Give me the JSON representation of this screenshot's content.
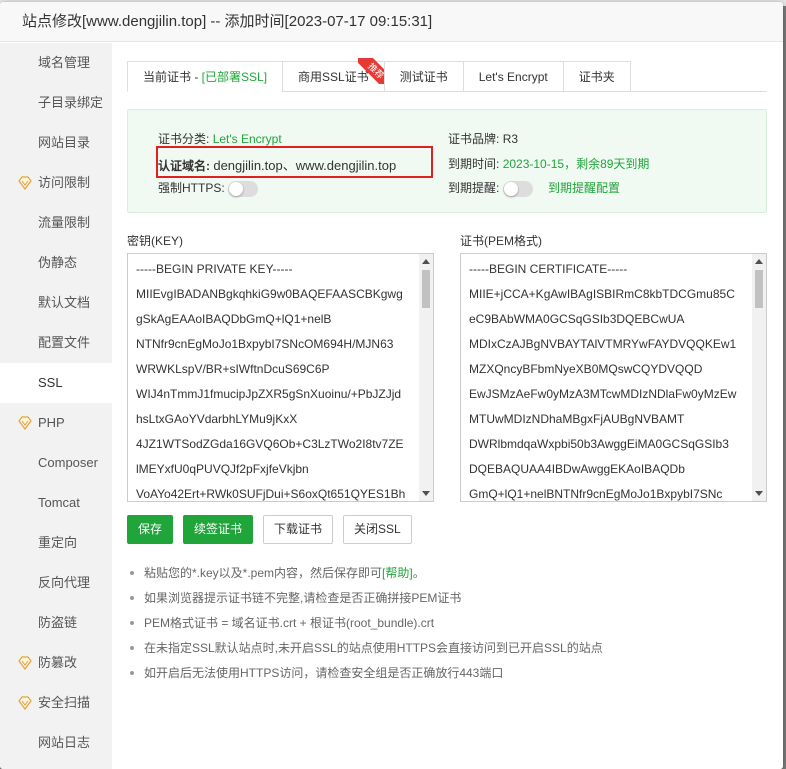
{
  "dialog": {
    "title": "站点修改[www.dengjilin.top] -- 添加时间[2023-07-17 09:15:31]",
    "close_label": "×"
  },
  "sidebar": {
    "items": [
      {
        "label": "域名管理",
        "icon": ""
      },
      {
        "label": "子目录绑定",
        "icon": ""
      },
      {
        "label": "网站目录",
        "icon": ""
      },
      {
        "label": "访问限制",
        "icon": "vip-diamond-icon"
      },
      {
        "label": "流量限制",
        "icon": ""
      },
      {
        "label": "伪静态",
        "icon": ""
      },
      {
        "label": "默认文档",
        "icon": ""
      },
      {
        "label": "配置文件",
        "icon": ""
      },
      {
        "label": "SSL",
        "icon": "",
        "active": true
      },
      {
        "label": "PHP",
        "icon": "vip-diamond-icon"
      },
      {
        "label": "Composer",
        "icon": ""
      },
      {
        "label": "Tomcat",
        "icon": ""
      },
      {
        "label": "重定向",
        "icon": ""
      },
      {
        "label": "反向代理",
        "icon": ""
      },
      {
        "label": "防盗链",
        "icon": ""
      },
      {
        "label": "防篡改",
        "icon": "vip-diamond-icon"
      },
      {
        "label": "安全扫描",
        "icon": "vip-diamond-icon"
      },
      {
        "label": "网站日志",
        "icon": ""
      }
    ]
  },
  "tabs": {
    "current_prefix": "当前证书 - ",
    "current_status": "[已部署SSL]",
    "commercial": "商用SSL证书",
    "commercial_badge": "推荐",
    "test": "测试证书",
    "letsencrypt": "Let's Encrypt",
    "folder": "证书夹"
  },
  "cert_info": {
    "type_label": "证书分类:",
    "type_value": "Let's Encrypt",
    "brand_label": "证书品牌:",
    "brand_value": "R3",
    "domain_label": "认证域名:",
    "domain_value": "dengjilin.top、www.dengjilin.top",
    "expiry_label": "到期时间:",
    "expiry_value": "2023-10-15，剩余89天到期",
    "https_label": "强制HTTPS:",
    "reminder_label": "到期提醒:",
    "reminder_link": "到期提醒配置"
  },
  "key_box": {
    "label": "密钥(KEY)",
    "lines": [
      "-----BEGIN PRIVATE KEY-----",
      "MIIEvgIBADANBgkqhkiG9w0BAQEFAASCBKgwg",
      "gSkAgEAAoIBAQDbGmQ+lQ1+nelB",
      "NTNfr9cnEgMoJo1BxpybI7SNcOM694H/MJN63",
      "WRWKLspV/BR+sIWftnDcuS69C6P",
      "WIJ4nTmmJ1fmucipJpZXR5gSnXuoinu/+PbJZJjd",
      "hsLtxGAoYVdarbhLYMu9jKxX",
      "4JZ1WTSodZGda16GVQ6Ob+C3LzTWo2I8tv7ZE",
      "lMEYxfU0qPUVQJf2pFxjfeVkjbn",
      "VoAYo42Ert+RWk0SUFjDui+S6oxQt651QYES1Bh"
    ]
  },
  "cert_box": {
    "label": "证书(PEM格式)",
    "lines": [
      "-----BEGIN CERTIFICATE-----",
      "MIIE+jCCA+KgAwIBAgISBIRmC8kbTDCGmu85C",
      "eC9BAbWMA0GCSqGSIb3DQEBCwUA",
      "MDIxCzAJBgNVBAYTAlVTMRYwFAYDVQQKEw1",
      "MZXQncyBFbmNyeXB0MQswCQYDVQQD",
      "EwJSMzAeFw0yMzA3MTcwMDIzNDlaFw0yMzEw",
      "MTUwMDIzNDhaMBgxFjAUBgNVBAMT",
      "DWRlbmdqaWxpbi50b3AwggEiMA0GCSqGSIb3",
      "DQEBAQUAA4IBDwAwggEKAoIBAQDb",
      "GmQ+lQ1+nelBNTNfr9cnEgMoJo1BxpybI7SNc"
    ]
  },
  "buttons": {
    "save": "保存",
    "renew": "续签证书",
    "download": "下载证书",
    "close_ssl": "关闭SSL"
  },
  "tips": {
    "tip1_text": "粘贴您的*.key以及*.pem内容，然后保存即可",
    "tip1_link": "[帮助]",
    "tip1_end": "。",
    "tip2": "如果浏览器提示证书链不完整,请检查是否正确拼接PEM证书",
    "tip3": "PEM格式证书 = 域名证书.crt + 根证书(root_bundle).crt",
    "tip4": "在未指定SSL默认站点时,未开启SSL的站点使用HTTPS会直接访问到已开启SSL的站点",
    "tip5": "如开启后无法使用HTTPS访问，请检查安全组是否正确放行443端口"
  },
  "colors": {
    "accent": "#20a53a",
    "highlight": "#e02020",
    "vip": "#e0a43a"
  }
}
